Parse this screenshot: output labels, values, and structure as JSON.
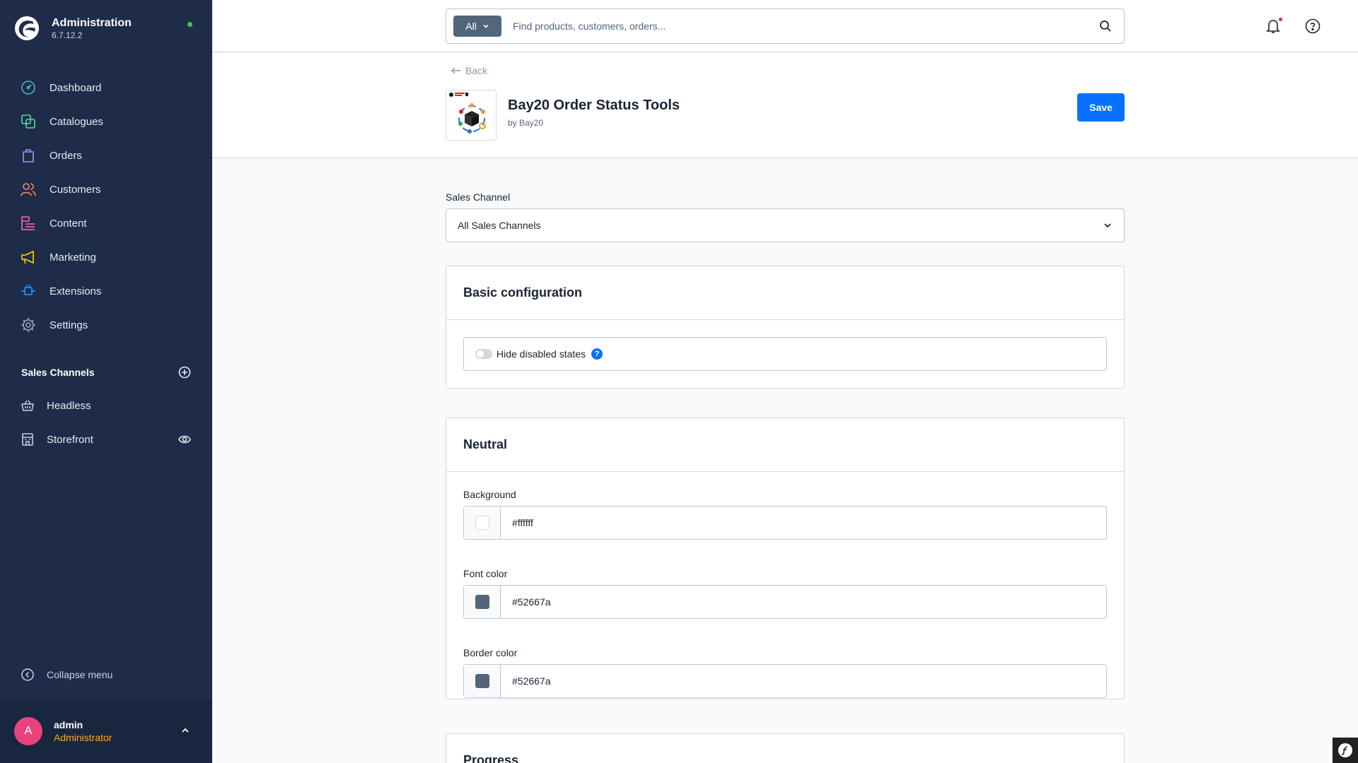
{
  "app": {
    "title": "Administration",
    "version": "6.7.12.2"
  },
  "nav": [
    {
      "id": "dashboard",
      "label": "Dashboard",
      "icon": "dashboard-icon",
      "color": "#4bb3c5"
    },
    {
      "id": "catalogues",
      "label": "Catalogues",
      "icon": "catalogues-icon",
      "color": "#57d9a3"
    },
    {
      "id": "orders",
      "label": "Orders",
      "icon": "orders-icon",
      "color": "#a092f0"
    },
    {
      "id": "customers",
      "label": "Customers",
      "icon": "customers-icon",
      "color": "#f88962"
    },
    {
      "id": "content",
      "label": "Content",
      "icon": "content-icon",
      "color": "#ff68b4"
    },
    {
      "id": "marketing",
      "label": "Marketing",
      "icon": "marketing-icon",
      "color": "#ffd700"
    },
    {
      "id": "extensions",
      "label": "Extensions",
      "icon": "extensions-icon",
      "color": "#189eff"
    },
    {
      "id": "settings",
      "label": "Settings",
      "icon": "settings-icon",
      "color": "#9aa8b5"
    }
  ],
  "sales_channels": {
    "title": "Sales Channels",
    "items": [
      {
        "label": "Headless",
        "icon": "basket-icon"
      },
      {
        "label": "Storefront",
        "icon": "storefront-icon"
      }
    ]
  },
  "collapse_label": "Collapse menu",
  "user": {
    "initial": "A",
    "name": "admin",
    "role": "Administrator"
  },
  "search": {
    "type": "All",
    "placeholder": "Find products, customers, orders..."
  },
  "header": {
    "back": "Back",
    "title": "Bay20 Order Status Tools",
    "by": "by Bay20",
    "save": "Save"
  },
  "sales_channel_field": {
    "label": "Sales Channel",
    "value": "All Sales Channels"
  },
  "basic_config": {
    "title": "Basic configuration",
    "switch_label": "Hide disabled states",
    "help": "?"
  },
  "neutral": {
    "title": "Neutral",
    "fields": [
      {
        "label": "Background",
        "value": "#ffffff"
      },
      {
        "label": "Font color",
        "value": "#52667a"
      },
      {
        "label": "Border color",
        "value": "#52667a"
      }
    ]
  },
  "progress": {
    "title": "Progress"
  }
}
